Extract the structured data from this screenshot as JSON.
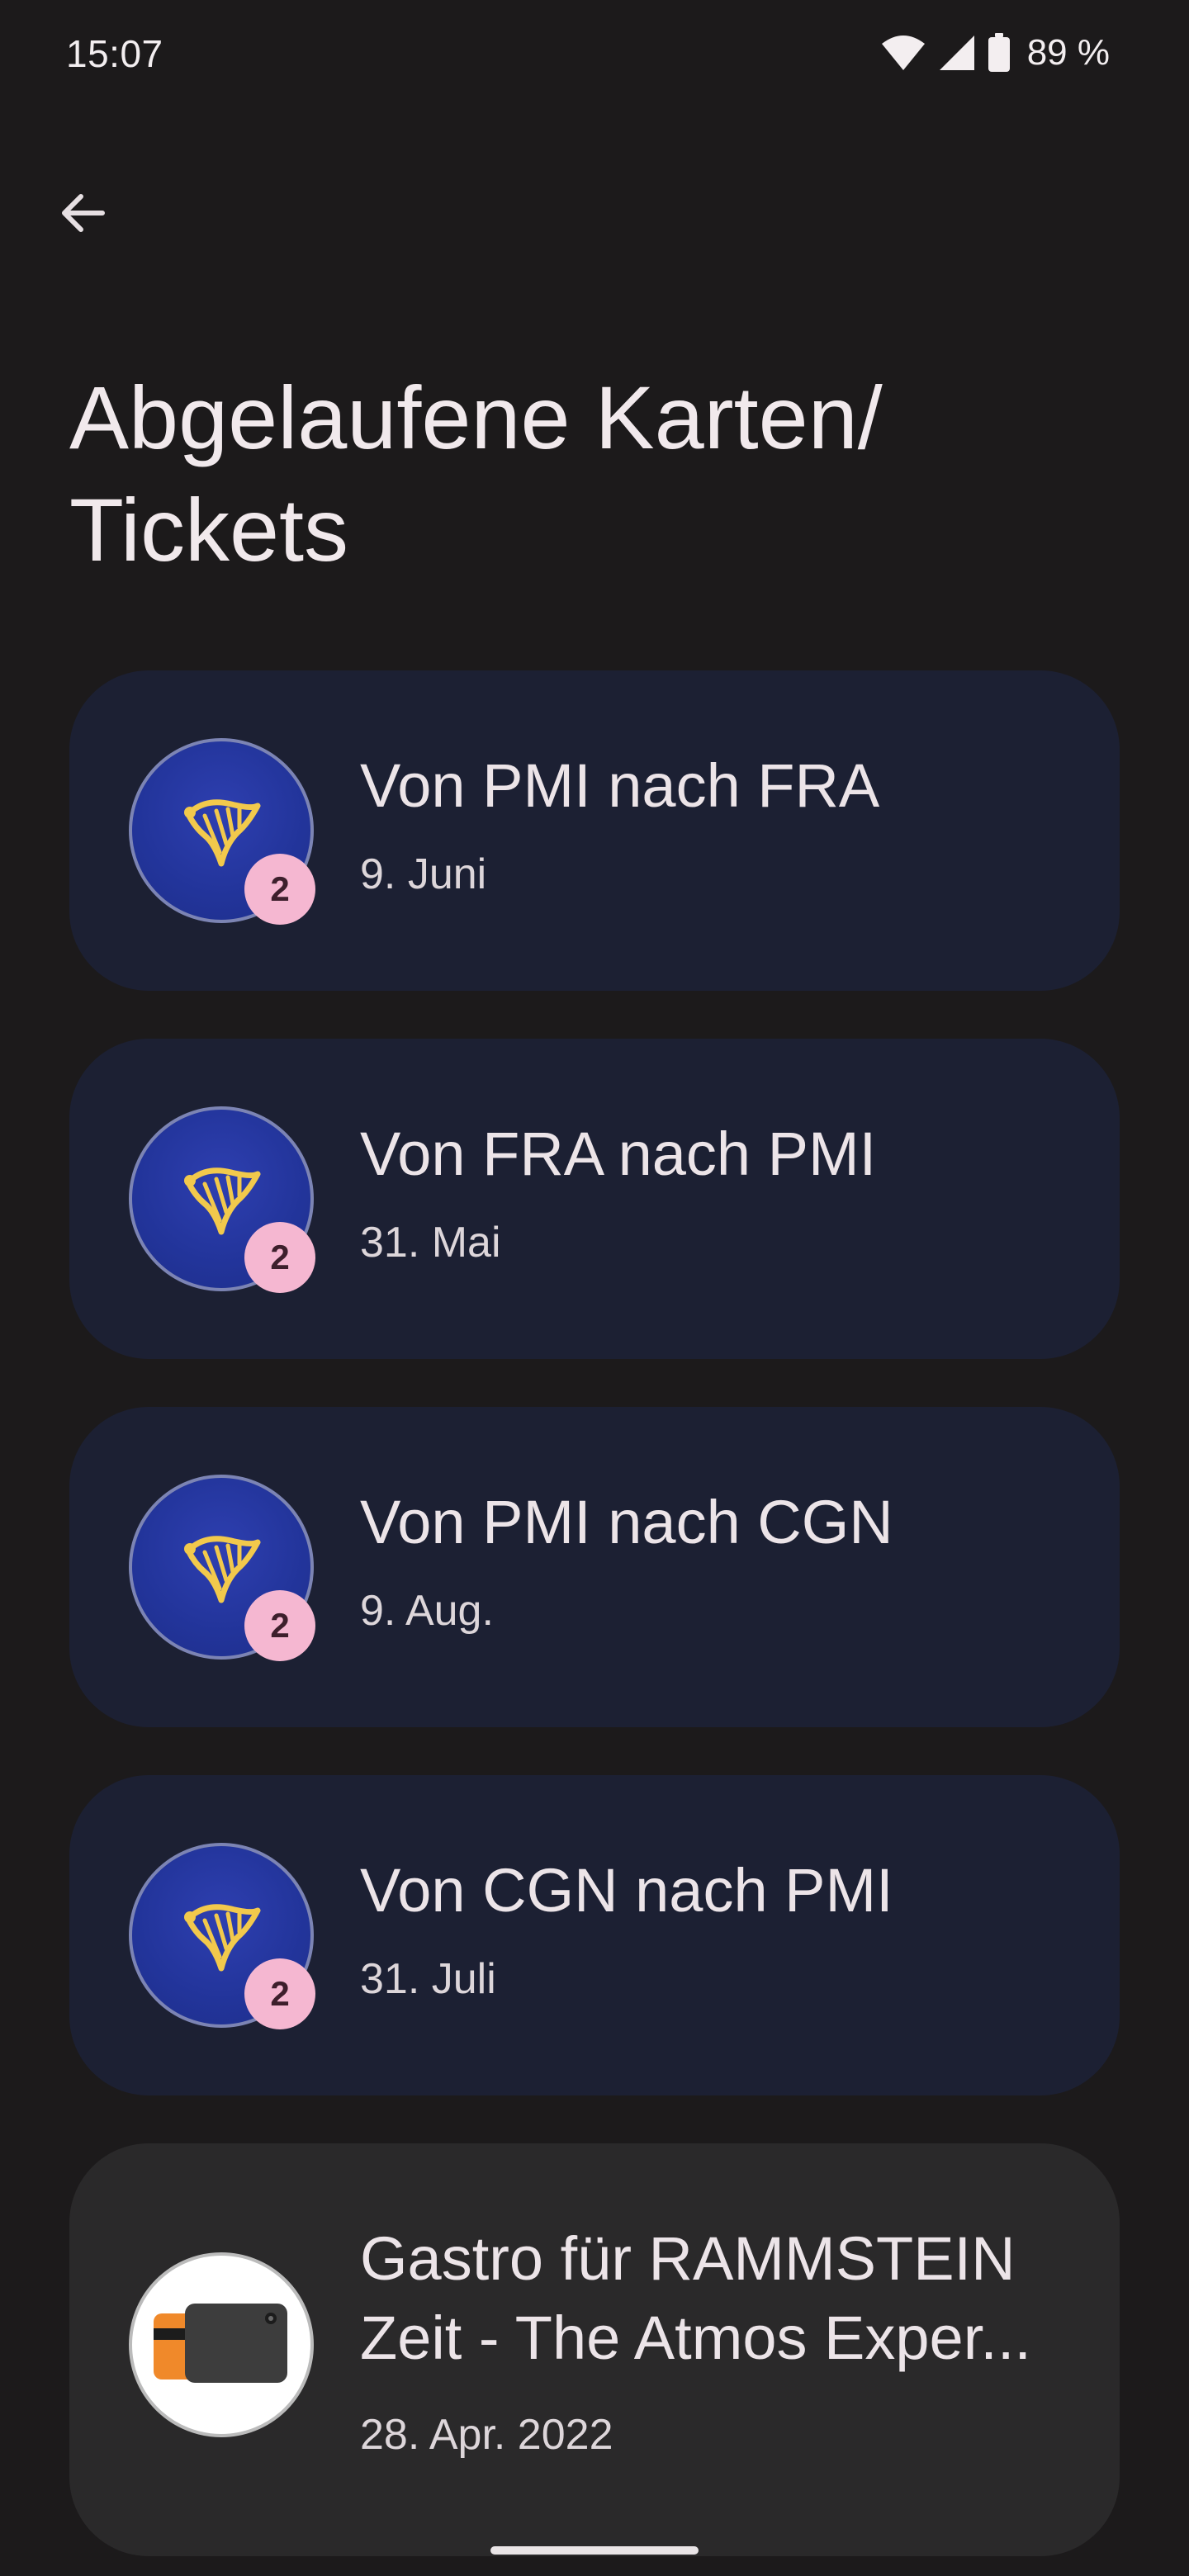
{
  "status_bar": {
    "time": "15:07",
    "battery": "89 %",
    "icons": [
      "wifi-icon",
      "cell-signal-icon",
      "battery-icon"
    ]
  },
  "header": {
    "back_icon": "arrow-left-icon",
    "title": "Abgelaufene Karten/ Tickets"
  },
  "tickets": [
    {
      "title": "Von PMI nach FRA",
      "date": "9. Juni",
      "badge": "2",
      "logo": "harp-logo-icon"
    },
    {
      "title": "Von FRA nach PMI",
      "date": "31. Mai",
      "badge": "2",
      "logo": "harp-logo-icon"
    },
    {
      "title": "Von PMI nach CGN",
      "date": "9. Aug.",
      "badge": "2",
      "logo": "harp-logo-icon"
    },
    {
      "title": "Von CGN nach PMI",
      "date": "31. Juli",
      "badge": "2",
      "logo": "harp-logo-icon"
    },
    {
      "title": "Gastro für RAMMSTEIN Zeit - The Atmos Exper...",
      "date": "28. Apr. 2022",
      "logo": "wallet-card-icon"
    }
  ],
  "colors": {
    "background": "#1c1a1b",
    "card_blue": "#1c2033",
    "card_neutral": "#2a292a",
    "badge": "#f5b7d1",
    "logo_blue": "#22349a",
    "logo_gold": "#f2c94c"
  }
}
